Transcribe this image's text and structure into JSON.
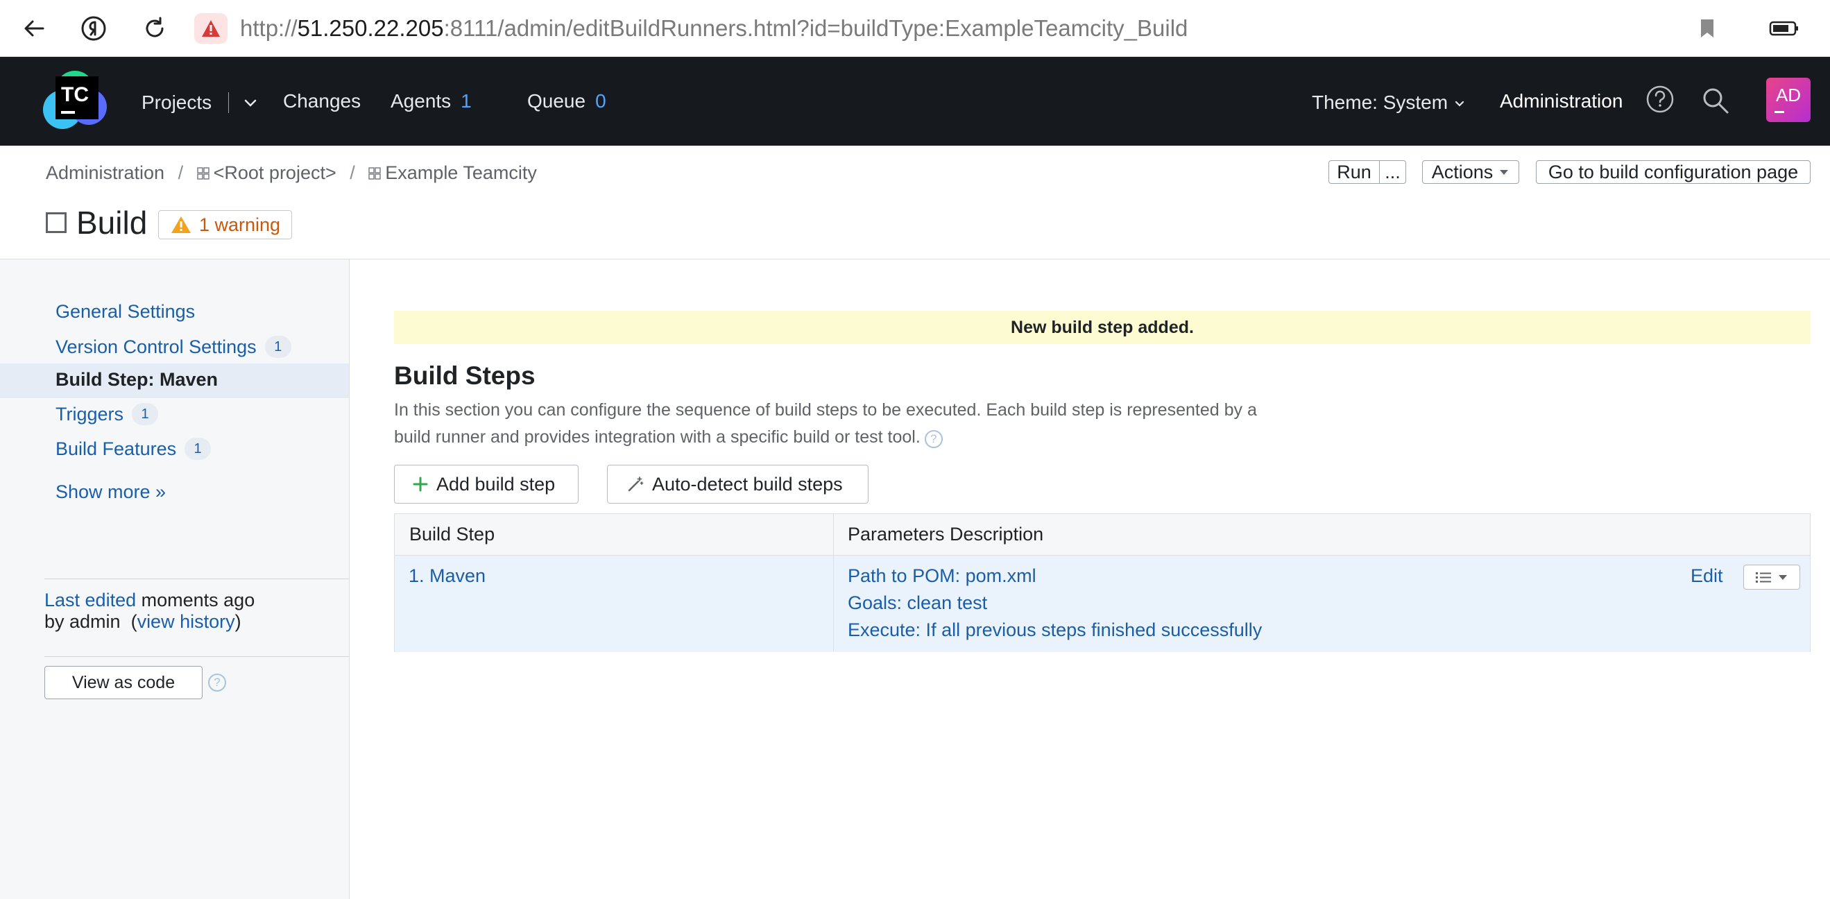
{
  "browser": {
    "url_prefix": "http://",
    "url_host": "51.250.22.205",
    "url_rest": ":8111/admin/editBuildRunners.html?id=buildType:ExampleTeamcity_Build"
  },
  "header": {
    "logo_text": "TC",
    "nav": {
      "projects": "Projects",
      "changes": "Changes",
      "agents": "Agents",
      "agents_count": "1",
      "queue": "Queue",
      "queue_count": "0"
    },
    "theme": "Theme: System",
    "administration": "Administration",
    "avatar": "AD"
  },
  "breadcrumb": {
    "items": [
      "Administration",
      "<Root project>",
      "Example Teamcity"
    ],
    "separator": "/"
  },
  "toolbar": {
    "run": "Run",
    "more": "...",
    "actions": "Actions",
    "goto": "Go to build configuration page"
  },
  "title": {
    "text": "Build",
    "warning": "1 warning"
  },
  "sidebar": {
    "items": [
      {
        "label": "General Settings",
        "badge": null
      },
      {
        "label": "Version Control Settings",
        "badge": "1"
      },
      {
        "label": "Build Step: Maven",
        "badge": null
      },
      {
        "label": "Triggers",
        "badge": "1"
      },
      {
        "label": "Build Features",
        "badge": "1"
      }
    ],
    "show_more": "Show more »",
    "last_edited_link": "Last edited",
    "last_edited_rest": "moments ago",
    "by_admin": "by admin",
    "view_history": "view history",
    "view_as_code": "View as code"
  },
  "main": {
    "notice": "New build step added.",
    "title": "Build Steps",
    "description": "In this section you can configure the sequence of build steps to be executed. Each build step is represented by a build runner and provides integration with a specific build or test tool.",
    "add_step": "Add build step",
    "auto_detect": "Auto-detect build steps",
    "table": {
      "headers": [
        "Build Step",
        "Parameters Description"
      ],
      "rows": [
        {
          "step": "1. Maven",
          "params": [
            "Path to POM: pom.xml",
            "Goals: clean test",
            "Execute: If all previous steps finished successfully"
          ],
          "edit": "Edit"
        }
      ]
    }
  },
  "colors": {
    "header_bg": "#16191d",
    "link": "#1a5ea8",
    "notice_bg": "#fdfbd1",
    "warning": "#c8580b",
    "count": "#4fa5ff"
  }
}
